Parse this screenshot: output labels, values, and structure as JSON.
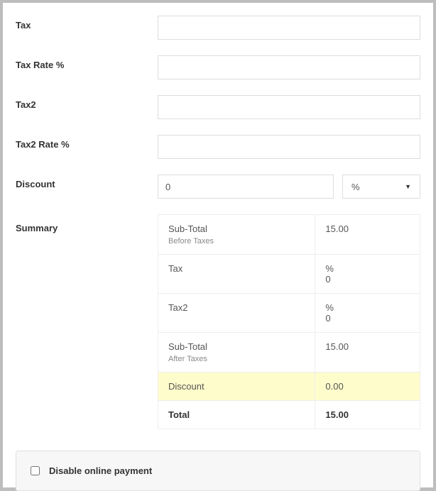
{
  "fields": {
    "tax_label": "Tax",
    "tax_value": "",
    "tax_rate_label": "Tax Rate %",
    "tax_rate_value": "",
    "tax2_label": "Tax2",
    "tax2_value": "",
    "tax2_rate_label": "Tax2 Rate %",
    "tax2_rate_value": "",
    "discount_label": "Discount",
    "discount_value": "0",
    "discount_unit": "%"
  },
  "summary": {
    "label": "Summary",
    "subtotal_before_label": "Sub-Total",
    "subtotal_before_sub": "Before Taxes",
    "subtotal_before_value": "15.00",
    "tax_label": "Tax",
    "tax_line1": "%",
    "tax_line2": "0",
    "tax2_label": "Tax2",
    "tax2_line1": "%",
    "tax2_line2": "0",
    "subtotal_after_label": "Sub-Total",
    "subtotal_after_sub": "After Taxes",
    "subtotal_after_value": "15.00",
    "discount_label": "Discount",
    "discount_value": "0.00",
    "total_label": "Total",
    "total_value": "15.00"
  },
  "options": {
    "disable_online_payment_label": "Disable online payment"
  }
}
